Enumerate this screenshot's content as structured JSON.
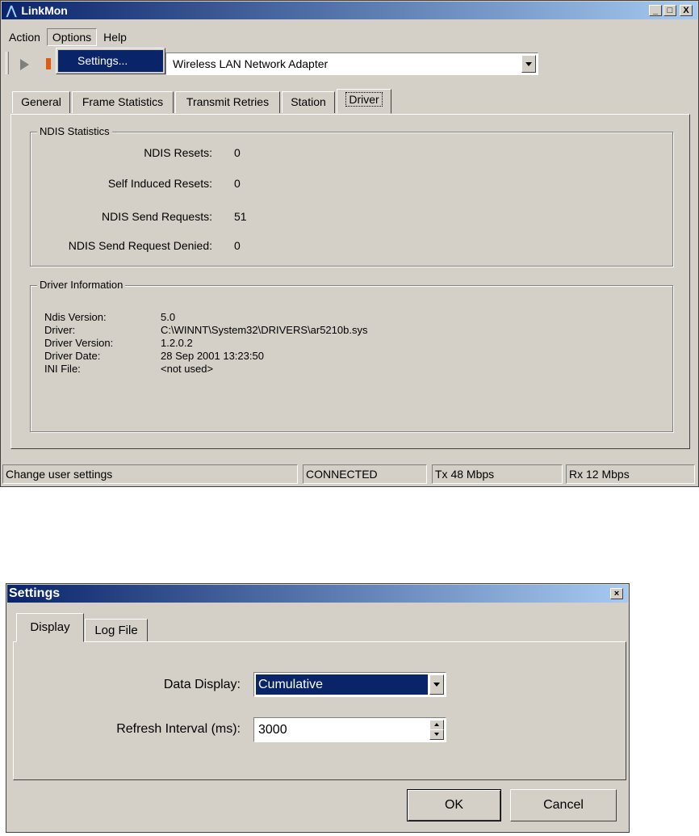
{
  "linkmon": {
    "title": "LinkMon",
    "title_controls": {
      "minimize": "_",
      "maximize": "□",
      "close": "X"
    },
    "menu": [
      "Action",
      "Options",
      "Help"
    ],
    "options_menu": {
      "item": "Settings..."
    },
    "adapter_select": {
      "value": "Wireless LAN Network Adapter"
    },
    "tabs": [
      "General",
      "Frame Statistics",
      "Transmit Retries",
      "Station",
      "Driver"
    ],
    "active_tab": "Driver",
    "ndis": {
      "legend": "NDIS Statistics",
      "rows": [
        {
          "label": "NDIS Resets:",
          "value": "0"
        },
        {
          "label": "Self Induced Resets:",
          "value": "0"
        },
        {
          "label": "NDIS Send Requests:",
          "value": "51"
        },
        {
          "label": "NDIS Send Request Denied:",
          "value": "0"
        }
      ]
    },
    "driver_info": {
      "legend": "Driver Information",
      "rows": [
        {
          "label": "Ndis Version:",
          "value": "5.0"
        },
        {
          "label": "Driver:",
          "value": "C:\\WINNT\\System32\\DRIVERS\\ar5210b.sys"
        },
        {
          "label": "Driver Version:",
          "value": "1.2.0.2"
        },
        {
          "label": "Driver Date:",
          "value": "28 Sep 2001 13:23:50"
        },
        {
          "label": "INI File:",
          "value": "<not used>"
        }
      ]
    },
    "status": {
      "message": "Change user settings",
      "connection": "CONNECTED",
      "tx": "Tx 48 Mbps",
      "rx": "Rx 12 Mbps"
    }
  },
  "settings": {
    "title": "Settings",
    "close": "×",
    "tabs": [
      "Display",
      "Log File"
    ],
    "active_tab": "Display",
    "data_display": {
      "label": "Data Display:",
      "value": "Cumulative"
    },
    "refresh_interval": {
      "label": "Refresh Interval (ms):",
      "value": "3000"
    },
    "ok_label": "OK",
    "cancel_label": "Cancel"
  },
  "colors": {
    "title_gradient_start": "#0a246a",
    "title_gradient_end": "#a6caf0",
    "selection": "#0a246a",
    "face": "#d4d0c8"
  }
}
